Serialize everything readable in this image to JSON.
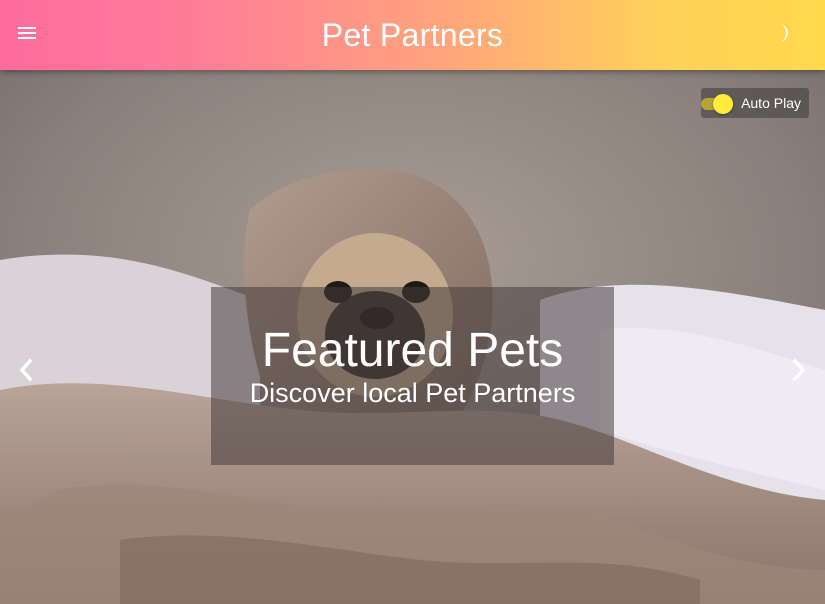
{
  "app_bar": {
    "title": "Pet Partners",
    "menu_icon": "menu-icon",
    "theme_icon": "moon-icon"
  },
  "carousel": {
    "autoplay_label": "Auto Play",
    "autoplay_on": true,
    "prev_icon": "chevron-left-icon",
    "next_icon": "chevron-right-icon",
    "caption_title": "Featured Pets",
    "caption_subtitle": "Discover local Pet Partners"
  },
  "colors": {
    "gradient_start": "#ff6b9e",
    "gradient_end": "#ffd94a",
    "toggle_thumb": "#ffeb3b"
  }
}
